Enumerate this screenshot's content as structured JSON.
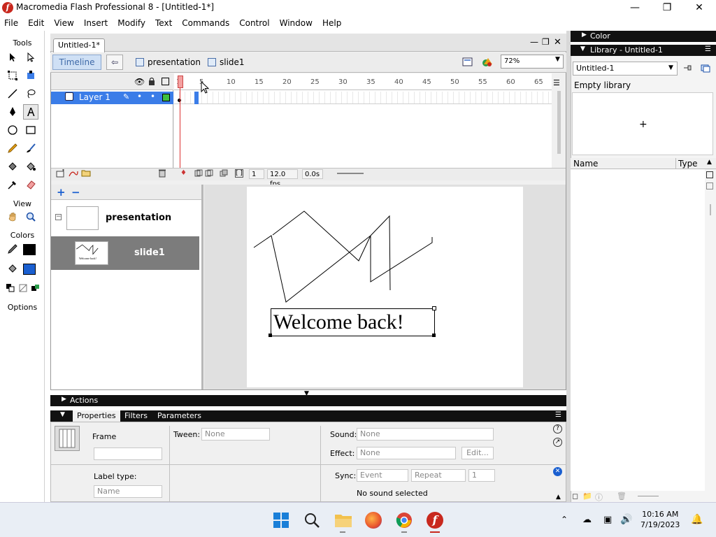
{
  "window": {
    "title": "Macromedia Flash Professional 8 - [Untitled-1*]",
    "app_icon_glyph": "f"
  },
  "menu": [
    "File",
    "Edit",
    "View",
    "Insert",
    "Modify",
    "Text",
    "Commands",
    "Control",
    "Window",
    "Help"
  ],
  "tools": {
    "label": "Tools",
    "view_label": "View",
    "colors_label": "Colors",
    "options_label": "Options",
    "stroke_color": "#000000",
    "fill_color": "#1a5fd0"
  },
  "document": {
    "tab": "Untitled-1*",
    "timeline_button": "Timeline",
    "breadcrumbs": [
      "presentation",
      "slide1"
    ],
    "zoom": "72%"
  },
  "timeline": {
    "layer_name": "Layer 1",
    "ruler": [
      "1",
      "5",
      "10",
      "15",
      "20",
      "25",
      "30",
      "35",
      "40",
      "45",
      "50",
      "55",
      "60",
      "65"
    ],
    "current_frame": "1",
    "fps": "12.0 fps",
    "time": "0.0s"
  },
  "slides": {
    "items": [
      "presentation",
      "slide1"
    ],
    "selected": "slide1",
    "thumb_text": "Welcome back!"
  },
  "stage": {
    "text": "Welcome back!"
  },
  "panels": {
    "actions": "Actions",
    "color": "Color",
    "library_title": "Library - Untitled-1"
  },
  "properties": {
    "tabs": [
      "Properties",
      "Filters",
      "Parameters"
    ],
    "frame_label": "Frame",
    "label_type_label": "Label type:",
    "label_type_value": "Name",
    "tween_label": "Tween:",
    "tween_value": "None",
    "sound_label": "Sound:",
    "sound_value": "None",
    "effect_label": "Effect:",
    "effect_value": "None",
    "edit_button": "Edit...",
    "sync_label": "Sync:",
    "sync_value": "Event",
    "repeat_value": "Repeat",
    "repeat_count": "1",
    "sound_status": "No sound selected"
  },
  "library": {
    "doc_select": "Untitled-1",
    "status": "Empty library",
    "columns": [
      "Name",
      "Type"
    ]
  },
  "taskbar": {
    "time": "10:16 AM",
    "date": "7/19/2023"
  }
}
